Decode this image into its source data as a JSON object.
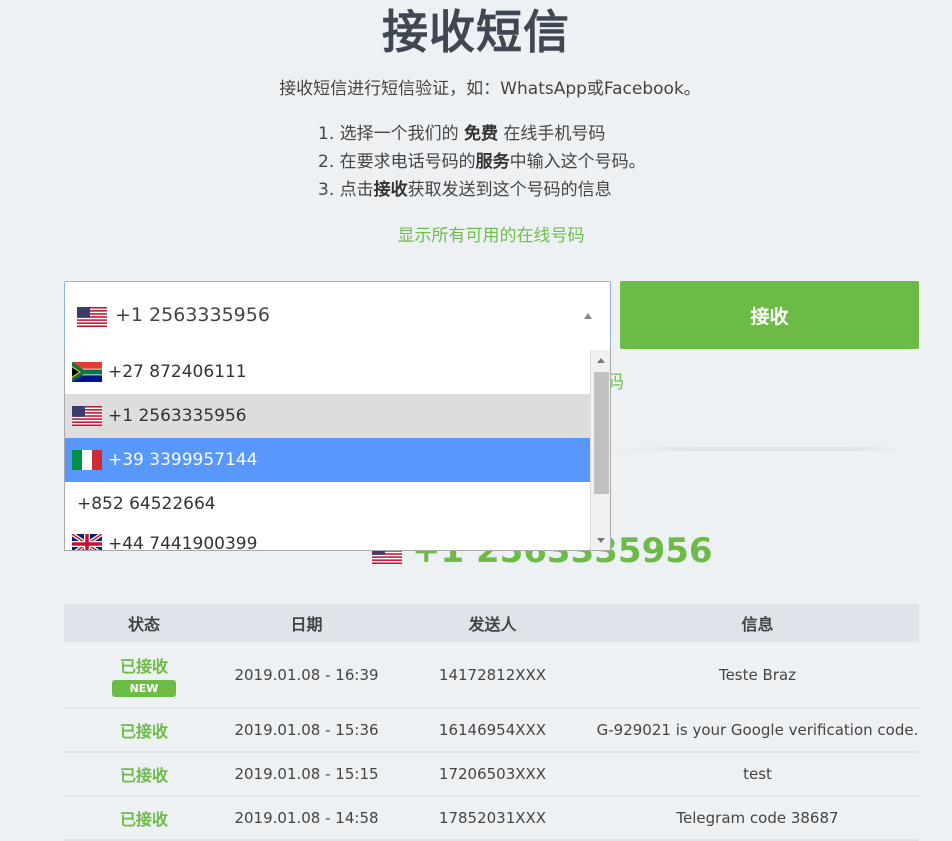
{
  "page": {
    "title": "接收短信",
    "subtitle": "接收短信进行短信验证，如：WhatsApp或Facebook。",
    "steps": [
      {
        "prefix": "1. 选择一个我们的 ",
        "bold": "免费",
        "suffix": " 在线手机号码"
      },
      {
        "prefix": "2. 在要求电话号码的",
        "bold": "服务",
        "suffix": "中输入这个号码。"
      },
      {
        "prefix": "3. 点击",
        "bold": "接收",
        "suffix": "获取发送到这个号码的信息"
      }
    ],
    "show_all_link": "显示所有可用的在线号码"
  },
  "selector": {
    "selected_value": "+1 2563335956",
    "selected_flag": "us-flag",
    "receive_button": "接收",
    "options": [
      {
        "label": "+27 872406111",
        "flag": "za-flag"
      },
      {
        "label": "+1 2563335956",
        "flag": "us-flag"
      },
      {
        "label": "+39 3399957144",
        "flag": "it-flag"
      },
      {
        "label": "+852 64522664",
        "flag": ""
      },
      {
        "label": "+44 7441900399",
        "flag": "gb-flag"
      }
    ]
  },
  "behind": {
    "partial_link_text": "码",
    "current_number": "+1 2563335956"
  },
  "table": {
    "headers": [
      "状态",
      "日期",
      "发送人",
      "信息"
    ],
    "rows": [
      {
        "status": "已接收",
        "badge": "NEW",
        "date": "2019.01.08 - 16:39",
        "sender": "14172812XXX",
        "message": "Teste Braz"
      },
      {
        "status": "已接收",
        "badge": "",
        "date": "2019.01.08 - 15:36",
        "sender": "16146954XXX",
        "message": "G-929021 is your Google verification code."
      },
      {
        "status": "已接收",
        "badge": "",
        "date": "2019.01.08 - 15:15",
        "sender": "17206503XXX",
        "message": "test"
      },
      {
        "status": "已接收",
        "badge": "",
        "date": "2019.01.08 - 14:58",
        "sender": "17852031XXX",
        "message": "Telegram code 38687"
      }
    ]
  },
  "colors": {
    "accent_green": "#6dbb47",
    "highlight_blue": "#5897fb",
    "background": "#eef1f4"
  }
}
